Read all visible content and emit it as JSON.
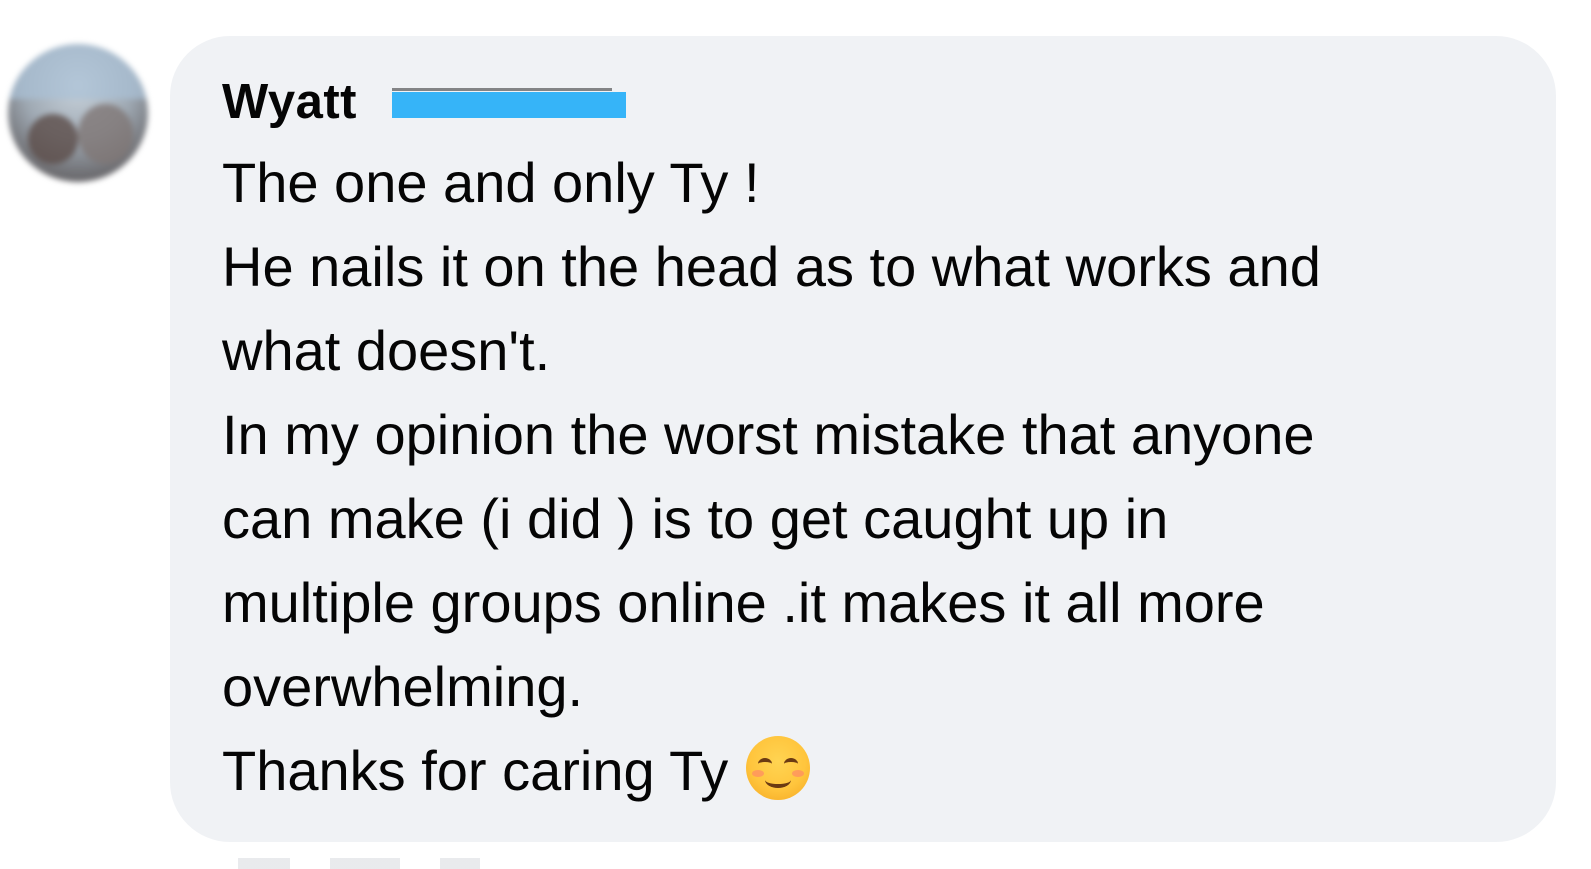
{
  "comment": {
    "author": {
      "first_name": "Wyatt",
      "last_name_redacted": true
    },
    "avatar_icon": "profile-photo-blurred",
    "lines": [
      "The one and only Ty !",
      "He nails it on the head as to what works and",
      "what doesn't.",
      "In my opinion the worst mistake that anyone",
      "can make (i did ) is to get caught up in",
      "multiple groups online .it makes it all more",
      "overwhelming.",
      "Thanks for caring Ty"
    ],
    "trailing_emoji": "smiling-face-with-smiling-eyes-icon"
  },
  "colors": {
    "bubble_background": "#f0f2f5",
    "text": "#050505",
    "redaction": "#36b4f8"
  }
}
